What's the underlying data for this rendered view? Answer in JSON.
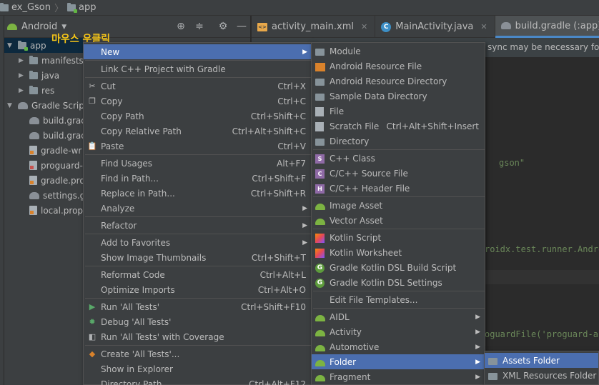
{
  "breadcrumb": {
    "project": "ex_Gson",
    "module": "app"
  },
  "project_panel": {
    "view_mode": "Android"
  },
  "tabs": [
    {
      "label": "activity_main.xml",
      "icon": "xml-file-icon",
      "active": false
    },
    {
      "label": "MainActivity.java",
      "icon": "java-class-icon",
      "active": false
    },
    {
      "label": "build.gradle (:app)",
      "icon": "gradle-icon",
      "active": true
    }
  ],
  "annotation": "마우스 우클릭",
  "tree": [
    {
      "label": "app",
      "icon": "module-folder-icon",
      "arrow": "▼",
      "indent": 0,
      "selected": true
    },
    {
      "label": "manifests",
      "icon": "folder-icon",
      "arrow": "▶",
      "indent": 1
    },
    {
      "label": "java",
      "icon": "folder-icon",
      "arrow": "▶",
      "indent": 1
    },
    {
      "label": "res",
      "icon": "folder-icon",
      "arrow": "▶",
      "indent": 1
    },
    {
      "label": "Gradle Scripts",
      "icon": "gradle-icon",
      "arrow": "▼",
      "indent": 0
    },
    {
      "label": "build.grad",
      "icon": "gradle-icon",
      "arrow": "",
      "indent": 1
    },
    {
      "label": "build.grad",
      "icon": "gradle-icon",
      "arrow": "",
      "indent": 1
    },
    {
      "label": "gradle-wr",
      "icon": "properties-file-icon",
      "arrow": "",
      "indent": 1
    },
    {
      "label": "proguard-",
      "icon": "text-file-icon",
      "arrow": "",
      "indent": 1
    },
    {
      "label": "gradle.pro",
      "icon": "properties-file-icon",
      "arrow": "",
      "indent": 1
    },
    {
      "label": "settings.g",
      "icon": "gradle-icon",
      "arrow": "",
      "indent": 1
    },
    {
      "label": "local.prop",
      "icon": "properties-file-icon",
      "arrow": "",
      "indent": 1
    }
  ],
  "editor": {
    "banner": "sync may be necessary for the",
    "lines": [
      {
        "text": "gson\""
      },
      {
        "text": "roidx.test.runner.Andro"
      },
      {
        "text": "oguardFile('proguard-an"
      }
    ]
  },
  "context_menu": [
    {
      "label": "New",
      "shortcut": "",
      "submenu": true,
      "highlighted": true,
      "icon": ""
    },
    {
      "separator": true
    },
    {
      "label": "Link C++ Project with Gradle",
      "shortcut": "",
      "icon": ""
    },
    {
      "separator": true
    },
    {
      "label": "Cut",
      "shortcut": "Ctrl+X",
      "icon": "scissors-icon",
      "glyph": "✂"
    },
    {
      "label": "Copy",
      "shortcut": "Ctrl+C",
      "icon": "copy-icon",
      "glyph": "❐"
    },
    {
      "label": "Copy Path",
      "shortcut": "Ctrl+Shift+C",
      "icon": ""
    },
    {
      "label": "Copy Relative Path",
      "shortcut": "Ctrl+Alt+Shift+C",
      "icon": ""
    },
    {
      "label": "Paste",
      "shortcut": "Ctrl+V",
      "icon": "paste-icon",
      "glyph": "📋"
    },
    {
      "separator": true
    },
    {
      "label": "Find Usages",
      "shortcut": "Alt+F7",
      "icon": ""
    },
    {
      "label": "Find in Path...",
      "shortcut": "Ctrl+Shift+F",
      "icon": ""
    },
    {
      "label": "Replace in Path...",
      "shortcut": "Ctrl+Shift+R",
      "icon": ""
    },
    {
      "label": "Analyze",
      "shortcut": "",
      "submenu": true,
      "icon": ""
    },
    {
      "separator": true
    },
    {
      "label": "Refactor",
      "shortcut": "",
      "submenu": true,
      "icon": ""
    },
    {
      "separator": true
    },
    {
      "label": "Add to Favorites",
      "shortcut": "",
      "submenu": true,
      "icon": ""
    },
    {
      "label": "Show Image Thumbnails",
      "shortcut": "Ctrl+Shift+T",
      "icon": ""
    },
    {
      "separator": true
    },
    {
      "label": "Reformat Code",
      "shortcut": "Ctrl+Alt+L",
      "icon": ""
    },
    {
      "label": "Optimize Imports",
      "shortcut": "Ctrl+Alt+O",
      "icon": ""
    },
    {
      "separator": true
    },
    {
      "label": "Run 'All Tests'",
      "shortcut": "Ctrl+Shift+F10",
      "icon": "run-icon",
      "glyph": "▶",
      "color": "#59a869"
    },
    {
      "label": "Debug 'All Tests'",
      "shortcut": "",
      "icon": "debug-icon",
      "glyph": "✹",
      "color": "#59a869"
    },
    {
      "label": "Run 'All Tests' with Coverage",
      "shortcut": "",
      "icon": "coverage-icon",
      "glyph": "◧",
      "color": "#afb1b3"
    },
    {
      "separator": true
    },
    {
      "label": "Create 'All Tests'...",
      "shortcut": "",
      "icon": "create-config-icon",
      "glyph": "◆",
      "color": "#d9822b"
    },
    {
      "label": "Show in Explorer",
      "shortcut": "",
      "icon": ""
    },
    {
      "label": "Directory Path",
      "shortcut": "Ctrl+Alt+F12",
      "icon": ""
    }
  ],
  "new_submenu": [
    {
      "label": "Module",
      "shortcut": "",
      "icon": "module-icon",
      "kind": "folder"
    },
    {
      "label": "Android Resource File",
      "shortcut": "",
      "icon": "android-resource-file-icon",
      "kind": "res"
    },
    {
      "label": "Android Resource Directory",
      "shortcut": "",
      "icon": "folder-icon",
      "kind": "folder"
    },
    {
      "label": "Sample Data Directory",
      "shortcut": "",
      "icon": "folder-icon",
      "kind": "folder"
    },
    {
      "label": "File",
      "shortcut": "",
      "icon": "file-icon",
      "kind": "gen"
    },
    {
      "label": "Scratch File",
      "shortcut": "Ctrl+Alt+Shift+Insert",
      "icon": "scratch-file-icon",
      "kind": "gen"
    },
    {
      "label": "Directory",
      "shortcut": "",
      "icon": "folder-icon",
      "kind": "folder"
    },
    {
      "separator": true
    },
    {
      "label": "C++ Class",
      "shortcut": "",
      "icon": "cpp-class-icon",
      "kind": "c",
      "glyph": "S"
    },
    {
      "label": "C/C++ Source File",
      "shortcut": "",
      "icon": "cpp-source-icon",
      "kind": "c",
      "glyph": "C"
    },
    {
      "label": "C/C++ Header File",
      "shortcut": "",
      "icon": "cpp-header-icon",
      "kind": "c",
      "glyph": "H"
    },
    {
      "separator": true
    },
    {
      "label": "Image Asset",
      "shortcut": "",
      "icon": "android-icon",
      "kind": "droid"
    },
    {
      "label": "Vector Asset",
      "shortcut": "",
      "icon": "android-icon",
      "kind": "droid"
    },
    {
      "separator": true
    },
    {
      "label": "Kotlin Script",
      "shortcut": "",
      "icon": "kotlin-icon",
      "kind": "kotlin"
    },
    {
      "label": "Kotlin Worksheet",
      "shortcut": "",
      "icon": "kotlin-icon",
      "kind": "kotlin"
    },
    {
      "label": "Gradle Kotlin DSL Build Script",
      "shortcut": "",
      "icon": "gradle-g-icon",
      "kind": "g"
    },
    {
      "label": "Gradle Kotlin DSL Settings",
      "shortcut": "",
      "icon": "gradle-g-icon",
      "kind": "g"
    },
    {
      "separator": true
    },
    {
      "label": "Edit File Templates...",
      "shortcut": "",
      "icon": ""
    },
    {
      "separator": true
    },
    {
      "label": "AIDL",
      "shortcut": "",
      "submenu": true,
      "icon": "android-icon",
      "kind": "droid"
    },
    {
      "label": "Activity",
      "shortcut": "",
      "submenu": true,
      "icon": "android-icon",
      "kind": "droid"
    },
    {
      "label": "Automotive",
      "shortcut": "",
      "submenu": true,
      "icon": "android-icon",
      "kind": "droid"
    },
    {
      "label": "Folder",
      "shortcut": "",
      "submenu": true,
      "highlighted": true,
      "icon": "android-icon",
      "kind": "droid"
    },
    {
      "label": "Fragment",
      "shortcut": "",
      "submenu": true,
      "icon": "android-icon",
      "kind": "droid"
    }
  ],
  "folder_submenu": [
    {
      "label": "Assets Folder",
      "highlighted": true,
      "icon": "assets-folder-icon"
    },
    {
      "label": "XML Resources Folder",
      "icon": "xml-folder-icon"
    }
  ]
}
